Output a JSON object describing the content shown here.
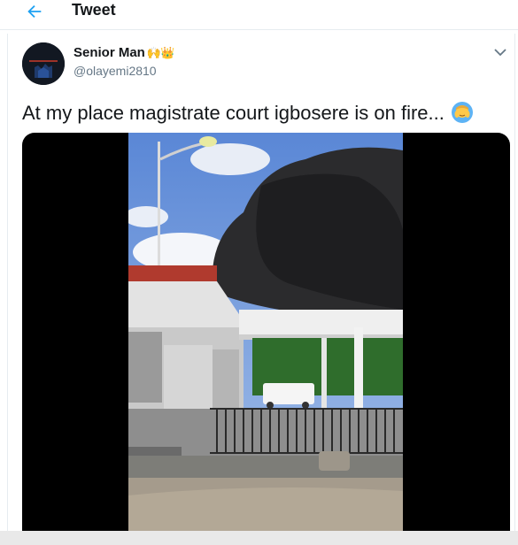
{
  "header": {
    "title": "Tweet",
    "back_icon": "arrow-left-icon",
    "accent_color": "#1da1f2"
  },
  "tweet": {
    "display_name": "Senior Man",
    "name_emojis": "🙌👑",
    "handle": "@olayemi2810",
    "text": "At my place magistrate court igbosere is on fire...",
    "text_emoji_icon": "person-facepalming-icon",
    "menu_icon": "chevron-down-icon",
    "media_type": "video"
  }
}
